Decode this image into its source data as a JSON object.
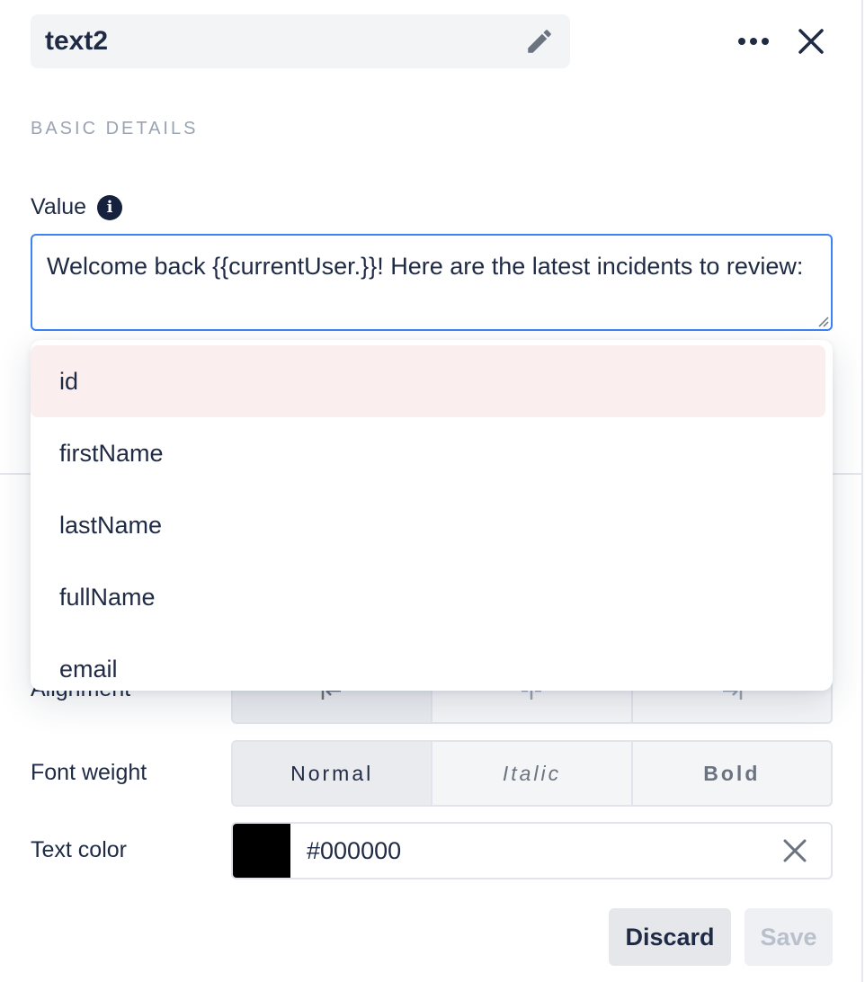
{
  "header": {
    "component_name": "text2"
  },
  "section": {
    "title": "BASIC DETAILS"
  },
  "value_field": {
    "label": "Value",
    "text": "Welcome back {{currentUser.}}! Here are the latest incidents to review:"
  },
  "autocomplete": {
    "items": [
      {
        "label": "id",
        "highlighted": true
      },
      {
        "label": "firstName",
        "highlighted": false
      },
      {
        "label": "lastName",
        "highlighted": false
      },
      {
        "label": "fullName",
        "highlighted": false
      },
      {
        "label": "email",
        "highlighted": false
      }
    ]
  },
  "alignment": {
    "label": "Alignment",
    "options": [
      "left",
      "center",
      "right"
    ]
  },
  "font_weight": {
    "label": "Font weight",
    "options": [
      "Normal",
      "Italic",
      "Bold"
    ],
    "selected": "Normal"
  },
  "text_color": {
    "label": "Text color",
    "value": "#000000"
  },
  "footer": {
    "discard_label": "Discard",
    "save_label": "Save"
  },
  "colors": {
    "focus_border": "#3b82f6",
    "highlight_bg": "#fbeeee",
    "text_primary": "#1f2a44",
    "muted": "#9aa3b2"
  }
}
